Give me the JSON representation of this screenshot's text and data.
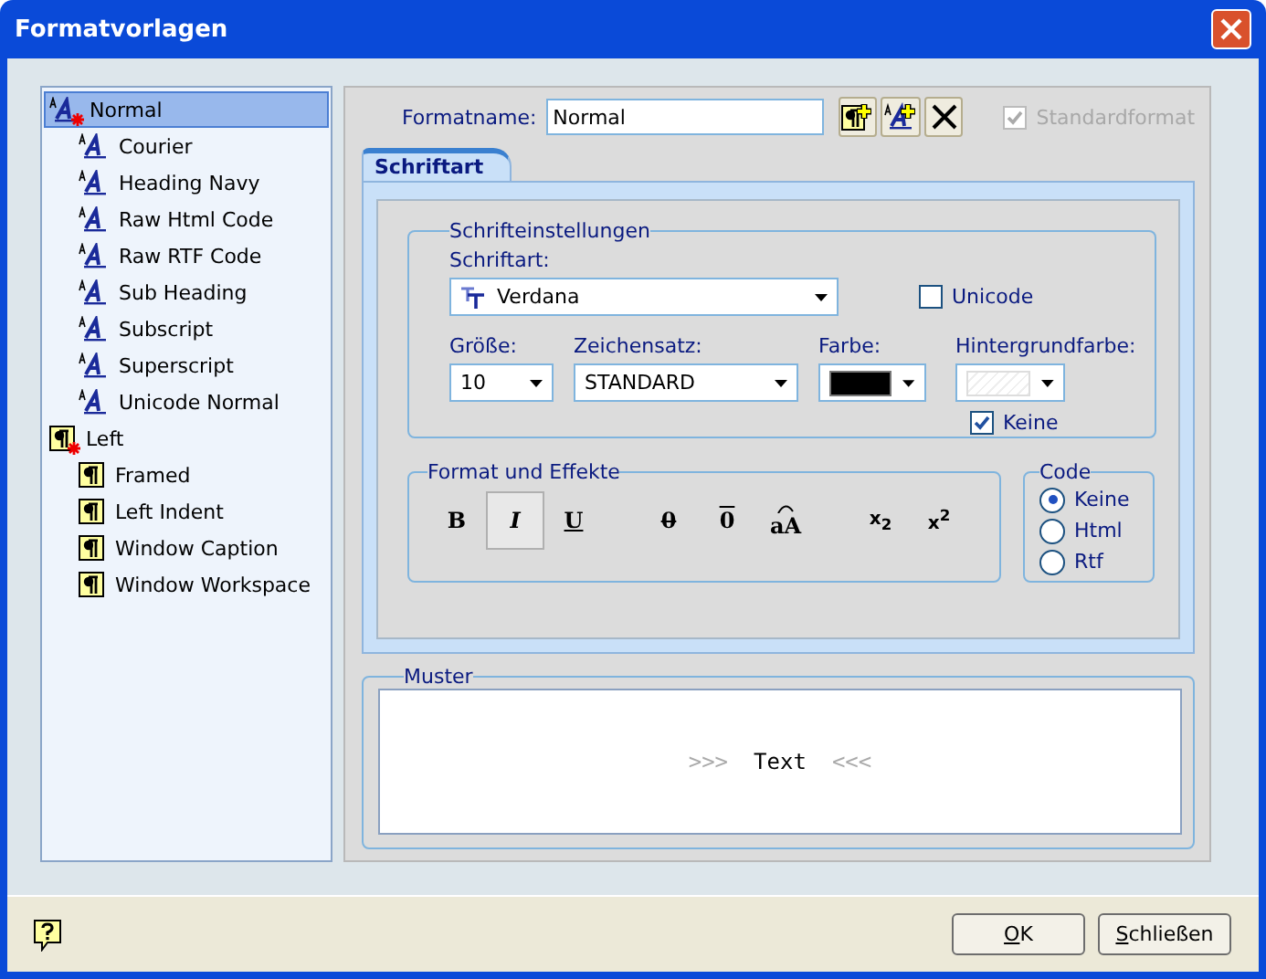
{
  "window": {
    "title": "Formatvorlagen"
  },
  "styles": [
    {
      "label": "Normal",
      "kind": "char",
      "default": true,
      "selected": true,
      "children": [
        {
          "label": "Courier",
          "kind": "char",
          "default": false,
          "selected": false
        },
        {
          "label": "Heading Navy",
          "kind": "char",
          "default": false,
          "selected": false
        },
        {
          "label": "Raw Html Code",
          "kind": "char",
          "default": false,
          "selected": false
        },
        {
          "label": "Raw RTF Code",
          "kind": "char",
          "default": false,
          "selected": false
        },
        {
          "label": "Sub Heading",
          "kind": "char",
          "default": false,
          "selected": false
        },
        {
          "label": "Subscript",
          "kind": "char",
          "default": false,
          "selected": false
        },
        {
          "label": "Superscript",
          "kind": "char",
          "default": false,
          "selected": false
        },
        {
          "label": "Unicode Normal",
          "kind": "char",
          "default": false,
          "selected": false
        }
      ]
    },
    {
      "label": "Left",
      "kind": "para",
      "default": true,
      "selected": false,
      "children": [
        {
          "label": "Framed",
          "kind": "para",
          "default": false,
          "selected": false
        },
        {
          "label": "Left Indent",
          "kind": "para",
          "default": false,
          "selected": false
        },
        {
          "label": "Window Caption",
          "kind": "para",
          "default": false,
          "selected": false
        },
        {
          "label": "Window Workspace",
          "kind": "para",
          "default": false,
          "selected": false
        }
      ]
    }
  ],
  "format_name": {
    "label": "Formatname:",
    "value": "Normal"
  },
  "standard_format": {
    "label": "Standardformat",
    "checked": true,
    "disabled": true
  },
  "tabs": [
    {
      "label": "Schriftart",
      "selected": true
    }
  ],
  "font_settings": {
    "legend": "Schrifteinstellungen",
    "font_label": "Schriftart:",
    "font": "Verdana",
    "unicode": {
      "label": "Unicode",
      "checked": false
    },
    "size_label": "Größe:",
    "size": "10",
    "charset_label": "Zeichensatz:",
    "charset": "STANDARD",
    "color_label": "Farbe:",
    "color": "#000000",
    "background_label": "Hintergrundfarbe:",
    "no_background": {
      "label": "Keine",
      "checked": true
    }
  },
  "effects": {
    "legend": "Format und Effekte",
    "groups": [
      [
        {
          "kind": "bold",
          "label": "B",
          "pressed": false
        },
        {
          "kind": "italic",
          "label": "I",
          "pressed": true
        },
        {
          "kind": "underline",
          "label": "U",
          "pressed": false
        }
      ],
      [
        {
          "kind": "strike",
          "label": "0",
          "pressed": false
        },
        {
          "kind": "overline",
          "label": "0",
          "pressed": false
        },
        {
          "kind": "case",
          "label": "aA",
          "pressed": false
        }
      ],
      [
        {
          "kind": "script",
          "label": "x$_{2}$",
          "pressed": false
        },
        {
          "kind": "script",
          "label": "x$^{2}$",
          "pressed": false
        }
      ]
    ]
  },
  "code": {
    "legend": "Code",
    "options": [
      {
        "label": "Keine",
        "selected": true
      },
      {
        "label": "Html",
        "selected": false
      },
      {
        "label": "Rtf",
        "selected": false
      }
    ]
  },
  "sample": {
    "legend": "Muster",
    "before": ">>>",
    "text": "Text",
    "after": "<<<"
  },
  "buttons": [
    {
      "label": "OK",
      "mnemonic": true
    },
    {
      "label": "Schließen",
      "mnemonic": true
    }
  ]
}
